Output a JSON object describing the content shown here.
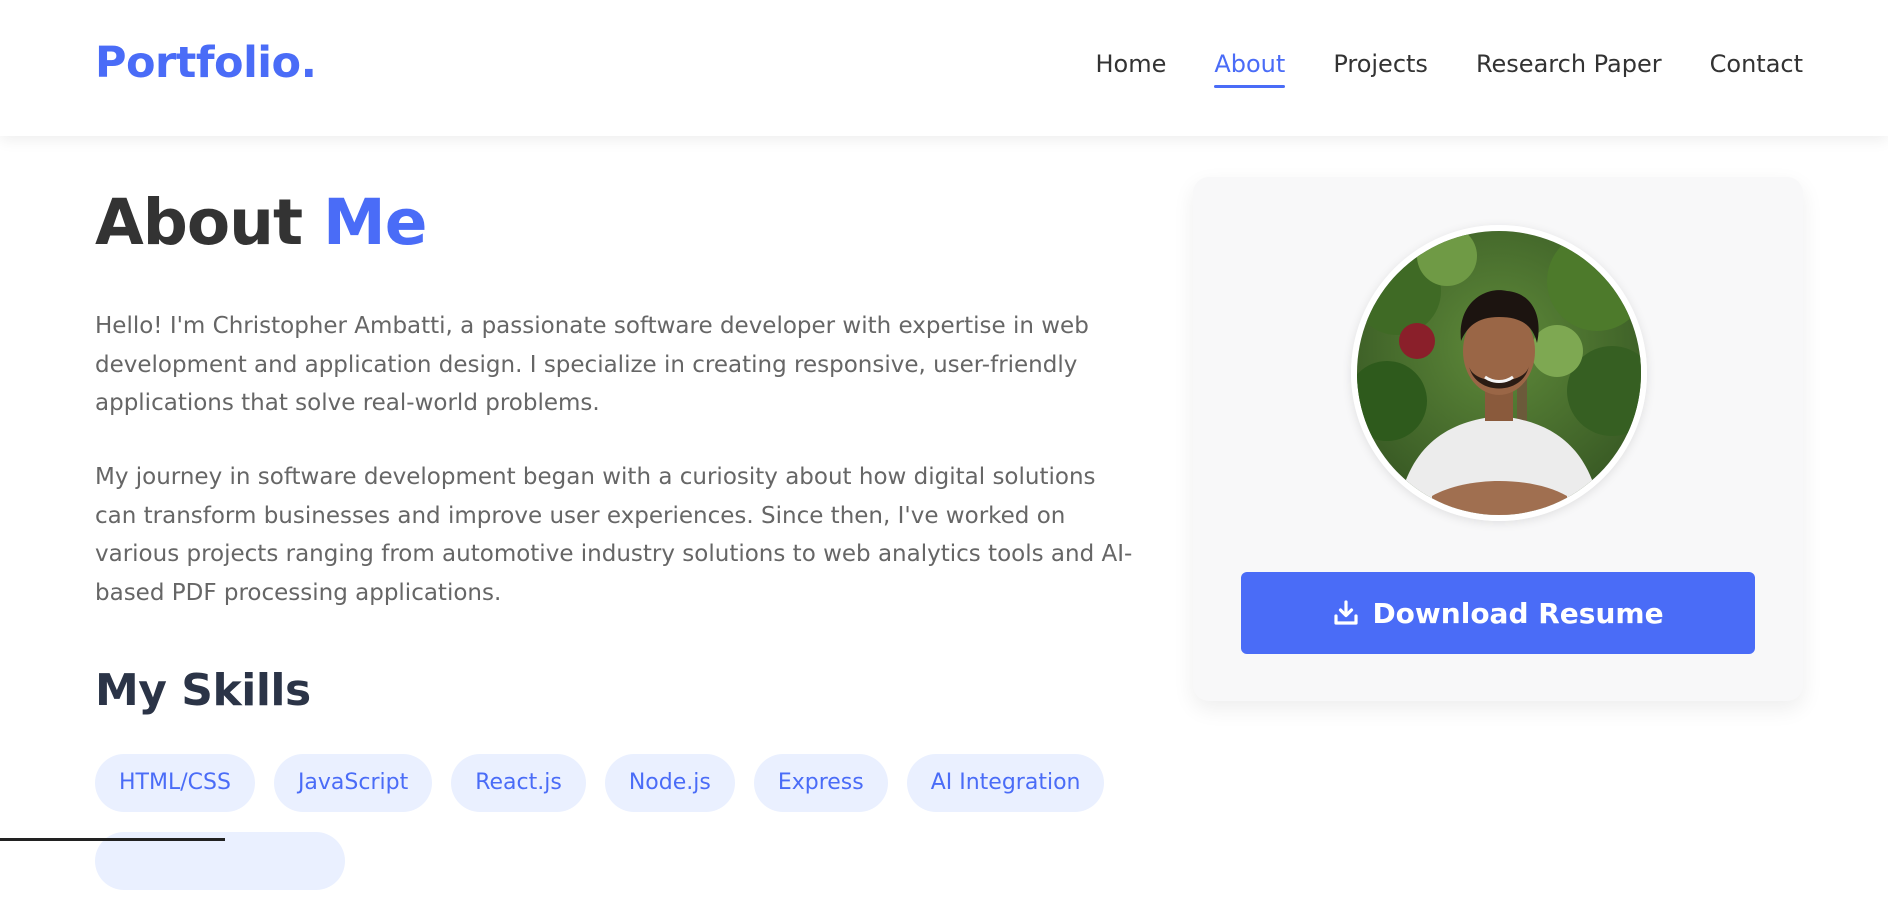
{
  "brand": {
    "logo": "Portfolio."
  },
  "nav": {
    "items": [
      {
        "label": "Home"
      },
      {
        "label": "About"
      },
      {
        "label": "Projects"
      },
      {
        "label": "Research Paper"
      },
      {
        "label": "Contact"
      }
    ],
    "active": "About"
  },
  "about": {
    "title_main": "About ",
    "title_accent": "Me",
    "paragraphs": [
      "Hello! I'm Christopher Ambatti, a passionate software developer with expertise in web development and application design. I specialize in creating responsive, user-friendly applications that solve real-world problems.",
      "My journey in software development began with a curiosity about how digital solutions can transform businesses and improve user experiences. Since then, I've worked on various projects ranging from automotive industry solutions to web analytics tools and AI-based PDF processing applications."
    ]
  },
  "skills": {
    "title": "My Skills",
    "items": [
      "HTML/CSS",
      "JavaScript",
      "React.js",
      "Node.js",
      "Express",
      "AI Integration",
      ""
    ]
  },
  "profile_card": {
    "photo_icon": "profile-photo",
    "download_icon": "download-icon",
    "download_label": "Download Resume"
  },
  "colors": {
    "accent": "#4a6cf7",
    "text_dark": "#333333",
    "text_muted": "#666666",
    "skill_bg": "#eaf0ff",
    "card_bg": "#f8f8f9"
  }
}
